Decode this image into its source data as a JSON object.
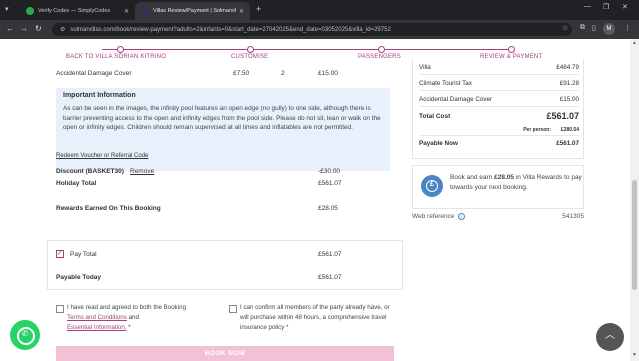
{
  "browser": {
    "tabs": [
      {
        "title": "Verify Codes — SimplyCodes",
        "active": false
      },
      {
        "title": "Villas Review/Payment | Solmarvilla",
        "active": true
      }
    ],
    "url": "solmarvillas.com/book/review-payment?adults=2&infants=0&start_date=27042025&end_date=03052025&villa_id=29752",
    "profile_initial": "M"
  },
  "stepper": {
    "steps": [
      {
        "label": "BACK TO VILLA SORIAN KITRINO"
      },
      {
        "label": "CUSTOMISE"
      },
      {
        "label": "PASSENGERS"
      },
      {
        "label": "REVIEW & PAYMENT"
      }
    ]
  },
  "main": {
    "damage_cover": {
      "label": "Accidental Damage Cover",
      "unit_price": "£7.50",
      "qty": "2",
      "total": "£15.00"
    },
    "important": {
      "title": "Important Information",
      "text": "As can be seen in the images, the infinity pool features an open edge (no gully) to one side, although there is barrier preventing access to the open and infinity edges from the pool side. Please do not sit, lean or walk on the open or infinity edges. Children should remain supervised at all times and inflatables are not permitted."
    },
    "redeem_link": "Redeem Voucher or Referral Code",
    "discount": {
      "label": "Discount (BASKET30)",
      "remove": "Remove",
      "value": "-£30.00"
    },
    "holiday_total": {
      "label": "Holiday Total",
      "value": "£561.07"
    },
    "rewards_earned": {
      "label": "Rewards Earned On This Booking",
      "value": "£28.05"
    },
    "pay_total": {
      "label": "Pay Total",
      "value": "£561.07",
      "checked": true
    },
    "payable_today": {
      "label": "Payable Today",
      "value": "£561.07"
    },
    "terms": {
      "prefix": "I have read and agreed to both the Booking",
      "terms_link": "Terms and Conditions",
      "and": "and",
      "essential_link": "Essential Information.",
      "asterisk": "*"
    },
    "confirm": {
      "text": "I can confirm all members of the party already have, or will purchase within 48 hours, a comprehensive travel insurance policy",
      "asterisk": "*"
    },
    "book_button": "BOOK NOW"
  },
  "summary": {
    "villa": {
      "label": "Villa",
      "value": "£484.79"
    },
    "tax": {
      "label": "Climate Tourist Tax",
      "value": "£91.28"
    },
    "damage": {
      "label": "Accidental Damage Cover",
      "value": "£15.00"
    },
    "total_cost": {
      "label": "Total Cost",
      "value": "£561.07"
    },
    "per_person": {
      "label": "Per person:",
      "value": "£280.54"
    },
    "payable_now": {
      "label": "Payable Now",
      "value": "£561.07"
    }
  },
  "rewards": {
    "pre": "Book and earn",
    "amount": "£28.05",
    "post": "in Villa Rewards to pay towards your next booking."
  },
  "web_reference": {
    "label": "Web reference",
    "value": "541305"
  },
  "colors": {
    "brand": "#a4407a",
    "info_bg": "#e8f1fb",
    "book_btn": "#f2c1d6",
    "whatsapp": "#25d366"
  }
}
